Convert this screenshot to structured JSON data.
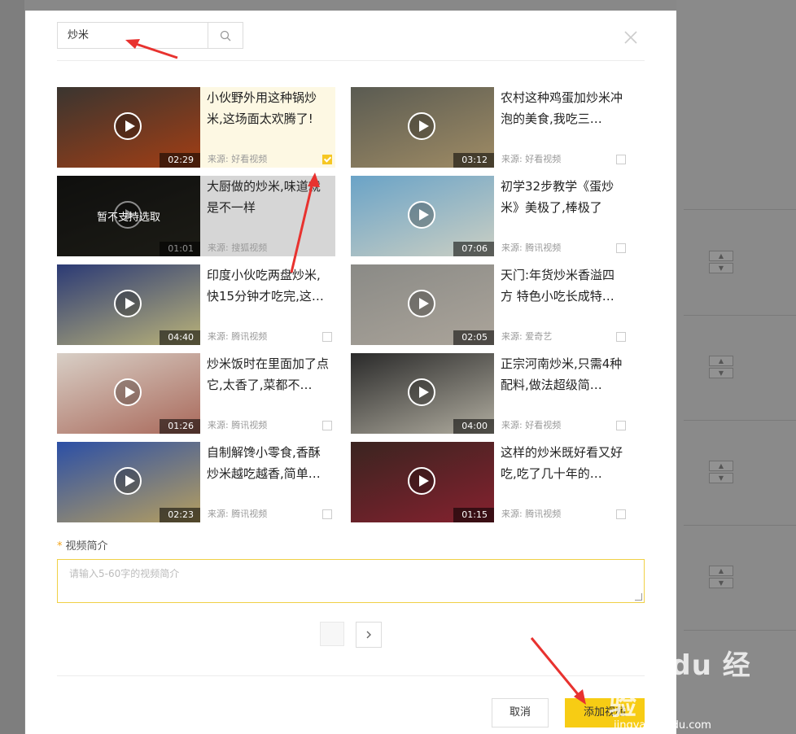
{
  "search": {
    "value": "炒米"
  },
  "videos": [
    {
      "title": "小伙野外用这种锅炒米,这场面太欢腾了!",
      "source": "来源: 好看视频",
      "duration": "02:29",
      "selected": true,
      "disabled": false,
      "thumb_color": "#3a3530",
      "thumb_accent": "#c2410c",
      "overlay": ""
    },
    {
      "title": "农村这种鸡蛋加炒米冲泡的美食,我吃三…",
      "source": "来源: 好看视频",
      "duration": "03:12",
      "selected": false,
      "disabled": false,
      "thumb_color": "#5a5b52",
      "thumb_accent": "#b49a6a",
      "overlay": ""
    },
    {
      "title": "大厨做的炒米,味道就是不一样",
      "source": "来源: 搜狐视频",
      "duration": "01:01",
      "selected": false,
      "disabled": true,
      "thumb_color": "#1c1c1a",
      "thumb_accent": "#3b3a2c",
      "overlay": "暂不支持选取"
    },
    {
      "title": "初学32步教学《蛋炒米》美极了,棒极了",
      "source": "来源: 腾讯视频",
      "duration": "07:06",
      "selected": false,
      "disabled": false,
      "thumb_color": "#6aa3c7",
      "thumb_accent": "#e8dcc2",
      "overlay": ""
    },
    {
      "title": "印度小伙吃两盘炒米,快15分钟才吃完,这…",
      "source": "来源: 腾讯视频",
      "duration": "04:40",
      "selected": false,
      "disabled": false,
      "thumb_color": "#2b3a75",
      "thumb_accent": "#e5d77a",
      "overlay": ""
    },
    {
      "title": "天门:年货炒米香溢四方 特色小吃长成特…",
      "source": "来源: 爱奇艺",
      "duration": "02:05",
      "selected": false,
      "disabled": false,
      "thumb_color": "#8a8a86",
      "thumb_accent": "#b5aca0",
      "overlay": ""
    },
    {
      "title": "炒米饭时在里面加了点它,太香了,菜都不…",
      "source": "来源: 腾讯视频",
      "duration": "01:26",
      "selected": false,
      "disabled": false,
      "thumb_color": "#d8cfc6",
      "thumb_accent": "#9b4a3a",
      "overlay": ""
    },
    {
      "title": "正宗河南炒米,只需4种配料,做法超级简…",
      "source": "来源: 好看视频",
      "duration": "04:00",
      "selected": false,
      "disabled": false,
      "thumb_color": "#2a2a2a",
      "thumb_accent": "#d8d3c2",
      "overlay": ""
    },
    {
      "title": "自制解馋小零食,香酥炒米越吃越香,简单…",
      "source": "来源: 腾讯视频",
      "duration": "02:23",
      "selected": false,
      "disabled": false,
      "thumb_color": "#2b4fa6",
      "thumb_accent": "#e0b74a",
      "overlay": ""
    },
    {
      "title": "这样的炒米既好看又好吃,吃了几十年的…",
      "source": "来源: 腾讯视频",
      "duration": "01:15",
      "selected": false,
      "disabled": false,
      "thumb_color": "#3a2420",
      "thumb_accent": "#9c2033",
      "overlay": ""
    }
  ],
  "intro": {
    "label": "视频简介",
    "required_mark": "*",
    "placeholder": "请输入5-60字的视频简介"
  },
  "footer": {
    "cancel_label": "取消",
    "add_label": "添加视频"
  },
  "watermark": {
    "brand": "Bai du 经验",
    "url": "jingyan.baidu.com"
  },
  "colors": {
    "accent": "#f7cc14",
    "annotation_arrow": "#e8322f",
    "selected_bg": "#fdf8e3"
  }
}
